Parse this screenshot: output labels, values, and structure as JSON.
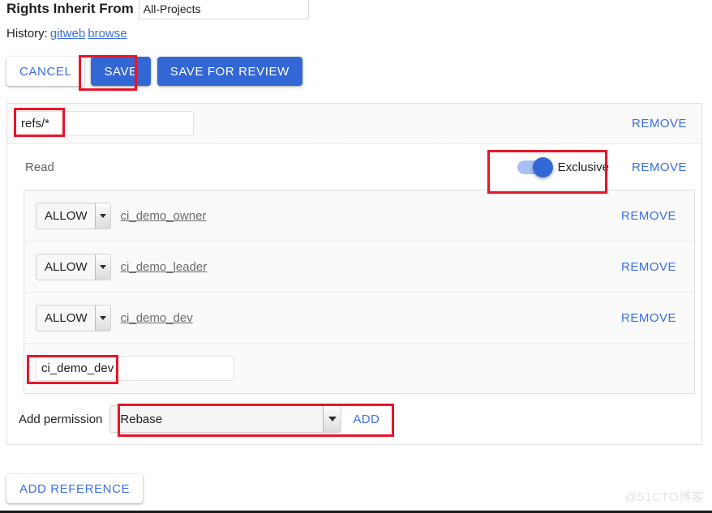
{
  "header": {
    "inherit_label": "Rights Inherit From",
    "inherit_value": "All-Projects",
    "history_label": "History:",
    "history_links": [
      {
        "label": "gitweb"
      },
      {
        "label": "browse"
      }
    ]
  },
  "actions": {
    "cancel_label": "CANCEL",
    "save_label": "SAVE",
    "save_for_review_label": "SAVE FOR REVIEW"
  },
  "reference": {
    "ref_value": "refs/*",
    "ref_placeholder": "",
    "remove_label": "REMOVE"
  },
  "permission": {
    "name": "Read",
    "exclusive_label": "Exclusive",
    "exclusive_on": true,
    "remove_label": "REMOVE",
    "rules": [
      {
        "action": "ALLOW",
        "group": "ci_demo_owner",
        "remove_label": "REMOVE"
      },
      {
        "action": "ALLOW",
        "group": "ci_demo_leader",
        "remove_label": "REMOVE"
      },
      {
        "action": "ALLOW",
        "group": "ci_demo_dev",
        "remove_label": "REMOVE"
      }
    ],
    "new_group_value": "ci_demo_dev",
    "new_group_placeholder": ""
  },
  "add_permission": {
    "label": "Add permission",
    "selected": "Rebase",
    "add_label": "ADD"
  },
  "footer": {
    "add_reference_label": "ADD REFERENCE",
    "watermark": "@51CTO博客"
  },
  "colors": {
    "primary_blue": "#3367d6",
    "link_blue": "#3b6ee8",
    "annotation_red": "#e8152a",
    "toggle_track": "#a9c0f5"
  }
}
